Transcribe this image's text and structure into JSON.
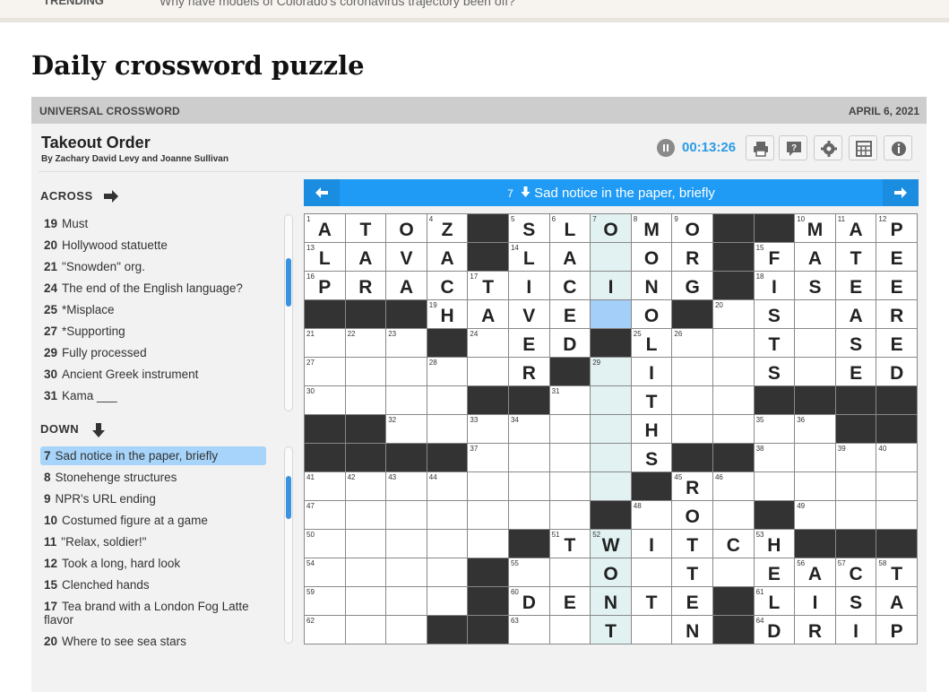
{
  "topstrip": {
    "tag": "TRENDING",
    "headline": "Why have models of Colorado's coronavirus trajectory been off?"
  },
  "page_title": "Daily crossword puzzle",
  "header": {
    "brand": "UNIVERSAL CROSSWORD",
    "date": "APRIL 6, 2021"
  },
  "puzzle": {
    "title": "Takeout Order",
    "byline": "By Zachary David Levy and Joanne Sullivan",
    "timer": "00:13:26"
  },
  "toolbar_icons": [
    "print-icon",
    "help-icon",
    "settings-icon",
    "grid-icon",
    "info-icon"
  ],
  "colors": {
    "accent": "#1f9bf5",
    "active_clue": "#a7d4fa",
    "cursor_cell": "#a4cff8",
    "word_highlight": "#e2f2f2",
    "block": "#333333"
  },
  "across": {
    "heading": "ACROSS",
    "clues": [
      {
        "num": "19",
        "text": "Must"
      },
      {
        "num": "20",
        "text": "Hollywood statuette"
      },
      {
        "num": "21",
        "text": "\"Snowden\" org."
      },
      {
        "num": "24",
        "text": "The end of the English language?"
      },
      {
        "num": "25",
        "text": "*Misplace"
      },
      {
        "num": "27",
        "text": "*Supporting"
      },
      {
        "num": "29",
        "text": "Fully processed"
      },
      {
        "num": "30",
        "text": "Ancient Greek instrument"
      },
      {
        "num": "31",
        "text": "Kama ___"
      }
    ]
  },
  "down": {
    "heading": "DOWN",
    "clues": [
      {
        "num": "7",
        "text": "Sad notice in the paper, briefly",
        "active": true
      },
      {
        "num": "8",
        "text": "Stonehenge structures"
      },
      {
        "num": "9",
        "text": "NPR's URL ending"
      },
      {
        "num": "10",
        "text": "Costumed figure at a game"
      },
      {
        "num": "11",
        "text": "\"Relax, soldier!\""
      },
      {
        "num": "12",
        "text": "Took a long, hard look"
      },
      {
        "num": "15",
        "text": "Clenched hands"
      },
      {
        "num": "17",
        "text": "Tea brand with a London Fog Latte flavor"
      },
      {
        "num": "20",
        "text": "Where to see sea stars"
      }
    ]
  },
  "current_clue": {
    "num": "7",
    "text": "Sad notice in the paper, briefly"
  },
  "grid": {
    "rows": [
      "ATOZ#SLOMO##MAP",
      "LAVA#LA.OR#FATE",
      "PRACTICING#ISEE",
      "###HAVE.O#.S.AR",
      "...#.ED#L..T.SE",
      "....R#.I..S.ED",
      "....##.T...#####",
      "##....H..##..##",
      "####...S##.....",
      "......#R.......",
      ".......#.O..#...",
      "....#TWITCH####",
      "...#...OTE.EACT",
      "...#DENTE#LISA",
      "..##..T.N#DRIP"
    ],
    "cells": [
      [
        {
          "n": "1",
          "l": "A"
        },
        {
          "l": "T"
        },
        {
          "l": "O"
        },
        {
          "n": "4",
          "l": "Z"
        },
        {
          "b": true
        },
        {
          "n": "5",
          "l": "S"
        },
        {
          "n": "6",
          "l": "L"
        },
        {
          "n": "7",
          "l": "O",
          "w": true
        },
        {
          "n": "8",
          "l": "M"
        },
        {
          "n": "9",
          "l": "O"
        },
        {
          "b": true
        },
        {
          "b": true
        },
        {
          "n": "10",
          "l": "M"
        },
        {
          "n": "11",
          "l": "A"
        },
        {
          "n": "12",
          "l": "P"
        }
      ],
      [
        {
          "n": "13",
          "l": "L"
        },
        {
          "l": "A"
        },
        {
          "l": "V"
        },
        {
          "l": "A"
        },
        {
          "b": true
        },
        {
          "n": "14",
          "l": "L"
        },
        {
          "l": "A"
        },
        {
          "l": "",
          "w": true
        },
        {
          "l": "O"
        },
        {
          "l": "R"
        },
        {
          "b": true
        },
        {
          "n": "15",
          "l": "F"
        },
        {
          "l": "A"
        },
        {
          "l": "T"
        },
        {
          "l": "E"
        }
      ],
      [
        {
          "n": "16",
          "l": "P"
        },
        {
          "l": "R"
        },
        {
          "l": "A"
        },
        {
          "l": "C"
        },
        {
          "n": "17",
          "l": "T"
        },
        {
          "l": "I"
        },
        {
          "l": "C"
        },
        {
          "l": "I",
          "w": true
        },
        {
          "l": "N"
        },
        {
          "l": "G"
        },
        {
          "b": true
        },
        {
          "n": "18",
          "l": "I"
        },
        {
          "l": "S"
        },
        {
          "l": "E"
        },
        {
          "l": "E"
        }
      ],
      [
        {
          "b": true
        },
        {
          "b": true
        },
        {
          "b": true
        },
        {
          "n": "19",
          "l": "H"
        },
        {
          "l": "A"
        },
        {
          "l": "V"
        },
        {
          "l": "E"
        },
        {
          "l": "",
          "c": true
        },
        {
          "l": "O"
        },
        {
          "b": true
        },
        {
          "n": "20",
          "l": ""
        },
        {
          "l": "S"
        },
        {
          "l": ""
        },
        {
          "l": "A"
        },
        {
          "l": "R"
        }
      ],
      [
        {
          "n": "21",
          "l": ""
        },
        {
          "n": "22",
          "l": ""
        },
        {
          "n": "23",
          "l": ""
        },
        {
          "b": true
        },
        {
          "n": "24",
          "l": ""
        },
        {
          "l": "E"
        },
        {
          "l": "D"
        },
        {
          "b": true
        },
        {
          "n": "25",
          "l": "L"
        },
        {
          "n": "26",
          "l": ""
        },
        {
          "l": ""
        },
        {
          "l": "T"
        },
        {
          "l": ""
        },
        {
          "l": "S"
        },
        {
          "l": "E"
        }
      ],
      [
        {
          "n": "27",
          "l": ""
        },
        {
          "l": ""
        },
        {
          "l": ""
        },
        {
          "n": "28",
          "l": ""
        },
        {
          "l": ""
        },
        {
          "l": "R"
        },
        {
          "b": true
        },
        {
          "n": "29",
          "l": "",
          "w": true
        },
        {
          "l": "I"
        },
        {
          "l": ""
        },
        {
          "l": ""
        },
        {
          "l": "S"
        },
        {
          "l": ""
        },
        {
          "l": "E"
        },
        {
          "l": "D"
        }
      ],
      [
        {
          "n": "30",
          "l": ""
        },
        {
          "l": ""
        },
        {
          "l": ""
        },
        {
          "l": ""
        },
        {
          "b": true
        },
        {
          "b": true
        },
        {
          "n": "31",
          "l": ""
        },
        {
          "l": "",
          "w": true
        },
        {
          "l": "T"
        },
        {
          "l": ""
        },
        {
          "l": ""
        },
        {
          "b": true
        },
        {
          "b": true
        },
        {
          "b": true
        },
        {
          "b": true
        }
      ],
      [
        {
          "b": true
        },
        {
          "b": true
        },
        {
          "n": "32",
          "l": ""
        },
        {
          "l": ""
        },
        {
          "n": "33",
          "l": ""
        },
        {
          "n": "34",
          "l": ""
        },
        {
          "l": ""
        },
        {
          "l": "",
          "w": true
        },
        {
          "l": "H"
        },
        {
          "l": ""
        },
        {
          "l": ""
        },
        {
          "n": "35",
          "l": ""
        },
        {
          "n": "36",
          "l": ""
        },
        {
          "b": true
        },
        {
          "b": true
        }
      ],
      [
        {
          "b": true
        },
        {
          "b": true
        },
        {
          "b": true
        },
        {
          "b": true
        },
        {
          "n": "37",
          "l": ""
        },
        {
          "l": ""
        },
        {
          "l": ""
        },
        {
          "l": "",
          "w": true
        },
        {
          "l": "S"
        },
        {
          "b": true
        },
        {
          "b": true
        },
        {
          "n": "38",
          "l": ""
        },
        {
          "l": ""
        },
        {
          "n": "39",
          "l": ""
        },
        {
          "n": "40",
          "l": ""
        }
      ],
      [
        {
          "n": "41",
          "l": ""
        },
        {
          "n": "42",
          "l": ""
        },
        {
          "n": "43",
          "l": ""
        },
        {
          "n": "44",
          "l": ""
        },
        {
          "l": ""
        },
        {
          "l": ""
        },
        {
          "l": ""
        },
        {
          "l": "",
          "w": true
        },
        {
          "b": true
        },
        {
          "n": "45",
          "l": "R"
        },
        {
          "n": "46",
          "l": ""
        },
        {
          "l": ""
        },
        {
          "l": ""
        },
        {
          "l": ""
        },
        {
          "l": ""
        }
      ],
      [
        {
          "n": "47",
          "l": ""
        },
        {
          "l": ""
        },
        {
          "l": ""
        },
        {
          "l": ""
        },
        {
          "l": ""
        },
        {
          "l": ""
        },
        {
          "l": ""
        },
        {
          "b": true
        },
        {
          "n": "48",
          "l": ""
        },
        {
          "l": "O"
        },
        {
          "l": ""
        },
        {
          "b": true
        },
        {
          "n": "49",
          "l": ""
        },
        {
          "l": ""
        },
        {
          "l": ""
        }
      ],
      [
        {
          "n": "50",
          "l": ""
        },
        {
          "l": ""
        },
        {
          "l": ""
        },
        {
          "l": ""
        },
        {
          "l": ""
        },
        {
          "b": true
        },
        {
          "n": "51",
          "l": "T"
        },
        {
          "n": "52",
          "l": "W",
          "w": true
        },
        {
          "l": "I"
        },
        {
          "l": "T"
        },
        {
          "l": "C"
        },
        {
          "n": "53",
          "l": "H"
        },
        {
          "b": true
        },
        {
          "b": true
        },
        {
          "b": true
        }
      ],
      [
        {
          "n": "54",
          "l": ""
        },
        {
          "l": ""
        },
        {
          "l": ""
        },
        {
          "l": ""
        },
        {
          "b": true
        },
        {
          "n": "55",
          "l": ""
        },
        {
          "l": ""
        },
        {
          "l": "O",
          "w": true
        },
        {
          "l": ""
        },
        {
          "l": "T"
        },
        {
          "l": ""
        },
        {
          "l": "E"
        },
        {
          "n": "56",
          "l": "A"
        },
        {
          "n": "57",
          "l": "C"
        },
        {
          "n": "58",
          "l": "T"
        }
      ],
      [
        {
          "n": "59",
          "l": ""
        },
        {
          "l": ""
        },
        {
          "l": ""
        },
        {
          "l": ""
        },
        {
          "b": true
        },
        {
          "n": "60",
          "l": "D"
        },
        {
          "l": "E"
        },
        {
          "l": "N",
          "w": true
        },
        {
          "l": "T"
        },
        {
          "l": "E"
        },
        {
          "b": true
        },
        {
          "n": "61",
          "l": "L"
        },
        {
          "l": "I"
        },
        {
          "l": "S"
        },
        {
          "l": "A"
        }
      ],
      [
        {
          "n": "62",
          "l": ""
        },
        {
          "l": ""
        },
        {
          "l": ""
        },
        {
          "b": true
        },
        {
          "b": true
        },
        {
          "n": "63",
          "l": ""
        },
        {
          "l": ""
        },
        {
          "l": "T",
          "w": true
        },
        {
          "l": ""
        },
        {
          "l": "N"
        },
        {
          "b": true
        },
        {
          "n": "64",
          "l": "D"
        },
        {
          "l": "R"
        },
        {
          "l": "I"
        },
        {
          "l": "P"
        }
      ]
    ]
  }
}
